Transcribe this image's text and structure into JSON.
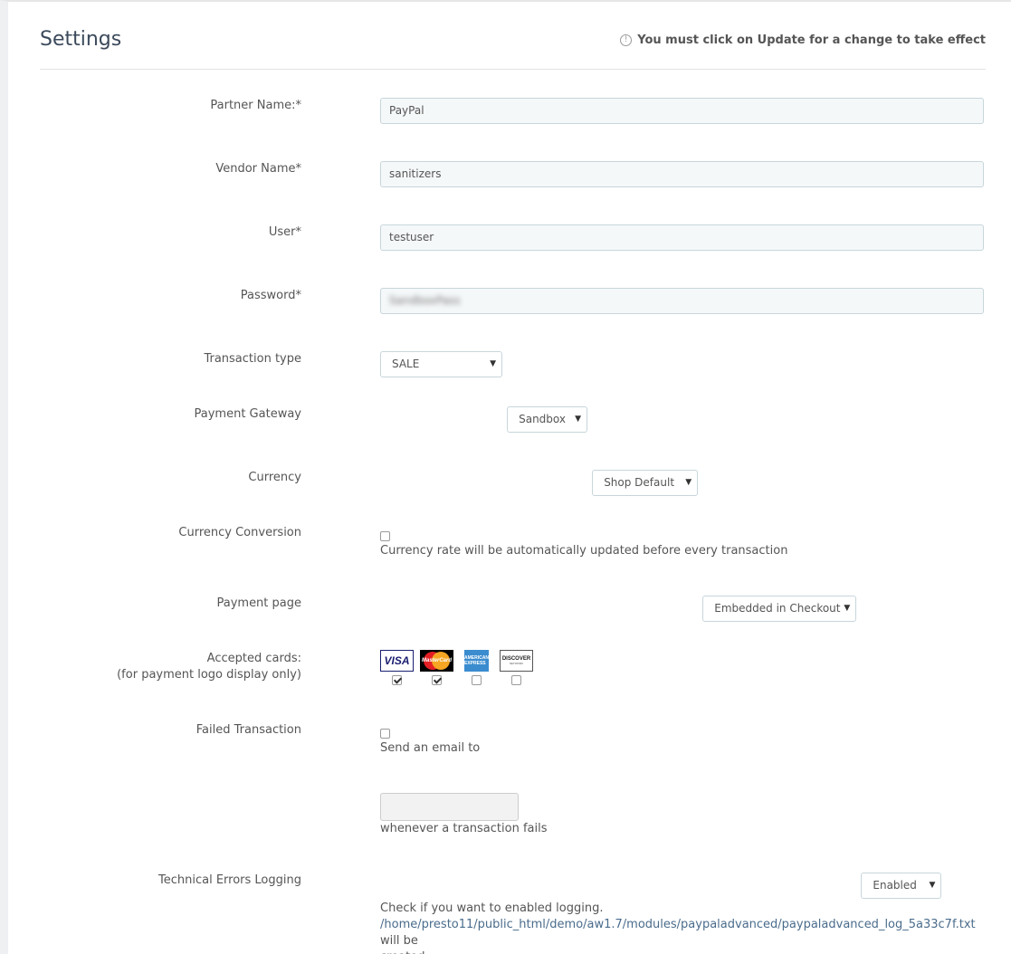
{
  "header": {
    "title": "Settings",
    "notice": "You must click on Update for a change to take effect",
    "notice_icon": "info-circle-icon"
  },
  "fields": {
    "partner_name": {
      "label": "Partner Name:*",
      "value": "PayPal"
    },
    "vendor_name": {
      "label": "Vendor Name*",
      "value": "sanitizers"
    },
    "user": {
      "label": "User*",
      "value": "testuser"
    },
    "password": {
      "label": "Password*",
      "value": "SandboxPass"
    },
    "transaction_type": {
      "label": "Transaction type",
      "value": "SALE"
    },
    "payment_gateway": {
      "label": "Payment Gateway",
      "value": "Sandbox"
    },
    "currency": {
      "label": "Currency",
      "value": "Shop Default"
    },
    "currency_conversion": {
      "label": "Currency Conversion",
      "checked": false,
      "help": "Currency rate will be automatically updated before every transaction"
    },
    "payment_page": {
      "label": "Payment page",
      "value": "Embedded in Checkout"
    },
    "accepted_cards": {
      "label_line1": "Accepted cards:",
      "label_line2": "(for payment logo display only)",
      "cards": [
        {
          "name": "visa",
          "logo_text": "VISA",
          "checked": true
        },
        {
          "name": "mastercard",
          "logo_text": "MasterCard",
          "checked": true
        },
        {
          "name": "amex",
          "logo_text": "AMERICAN EXPRESS",
          "checked": false
        },
        {
          "name": "discover",
          "logo_text": "DISCOVER",
          "logo_subtext": "NETWORK",
          "checked": false
        }
      ]
    },
    "failed_transaction": {
      "label": "Failed Transaction",
      "checked": false,
      "help_before": "Send an email to",
      "email_value": "",
      "help_after": "whenever a transaction fails"
    },
    "technical_errors_logging": {
      "label": "Technical Errors Logging",
      "value": "Enabled",
      "help": "Check if you want to enabled logging.",
      "log_path": "/home/presto11/public_html/demo/aw1.7/modules/paypaladvanced/paypaladvanced_log_5a33c7f.txt",
      "log_suffix_line1": "will be",
      "log_suffix_line2": "created"
    }
  },
  "colors": {
    "title": "#3c4a5c",
    "input_bg": "#f5f8f9",
    "input_border": "#c7d6db",
    "link": "#4a6c8c"
  }
}
